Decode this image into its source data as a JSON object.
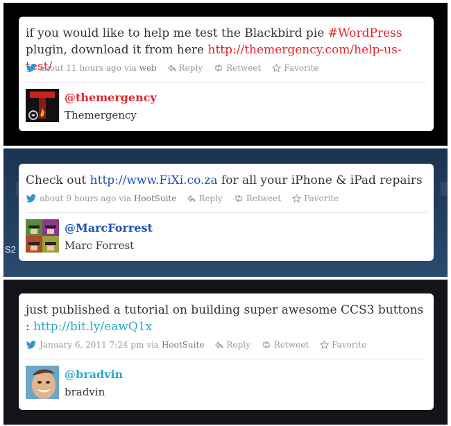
{
  "tweets": [
    {
      "text_pre": "if you would like to help me test the Blackbird pie ",
      "hashtag": "#WordPress",
      "text_mid": " plugin, download it from here ",
      "link": "http://themergency.com/help-us-test/",
      "time": "about 11 hours ago",
      "via_label": "via",
      "via": "web",
      "reply": "Reply",
      "retweet": "Retweet",
      "favorite": "Favorite",
      "handle": "@themergency",
      "name": "Themergency",
      "link_color": "#e0242b"
    },
    {
      "text_pre": "Check out ",
      "link": "http://www.FiXi.co.za",
      "text_post": " for all your iPhone & iPad repairs",
      "time": "about 9 hours ago",
      "via_label": "via",
      "via": "HootSuite",
      "reply": "Reply",
      "retweet": "Retweet",
      "favorite": "Favorite",
      "handle": "@MarcForrest",
      "name": "Marc Forrest",
      "link_color": "#1b52b4",
      "bg_tag": "S2"
    },
    {
      "text_pre": "just published a tutorial on building super awesome CCS3 buttons : ",
      "link": "http://bit.ly/eawQ1x",
      "time": "January 6, 2011 7:24 pm",
      "via_label": "via",
      "via": "HootSuite",
      "reply": "Reply",
      "retweet": "Retweet",
      "favorite": "Favorite",
      "handle": "@bradvin",
      "name": "bradvin",
      "link_color": "#2aa8c9"
    }
  ]
}
